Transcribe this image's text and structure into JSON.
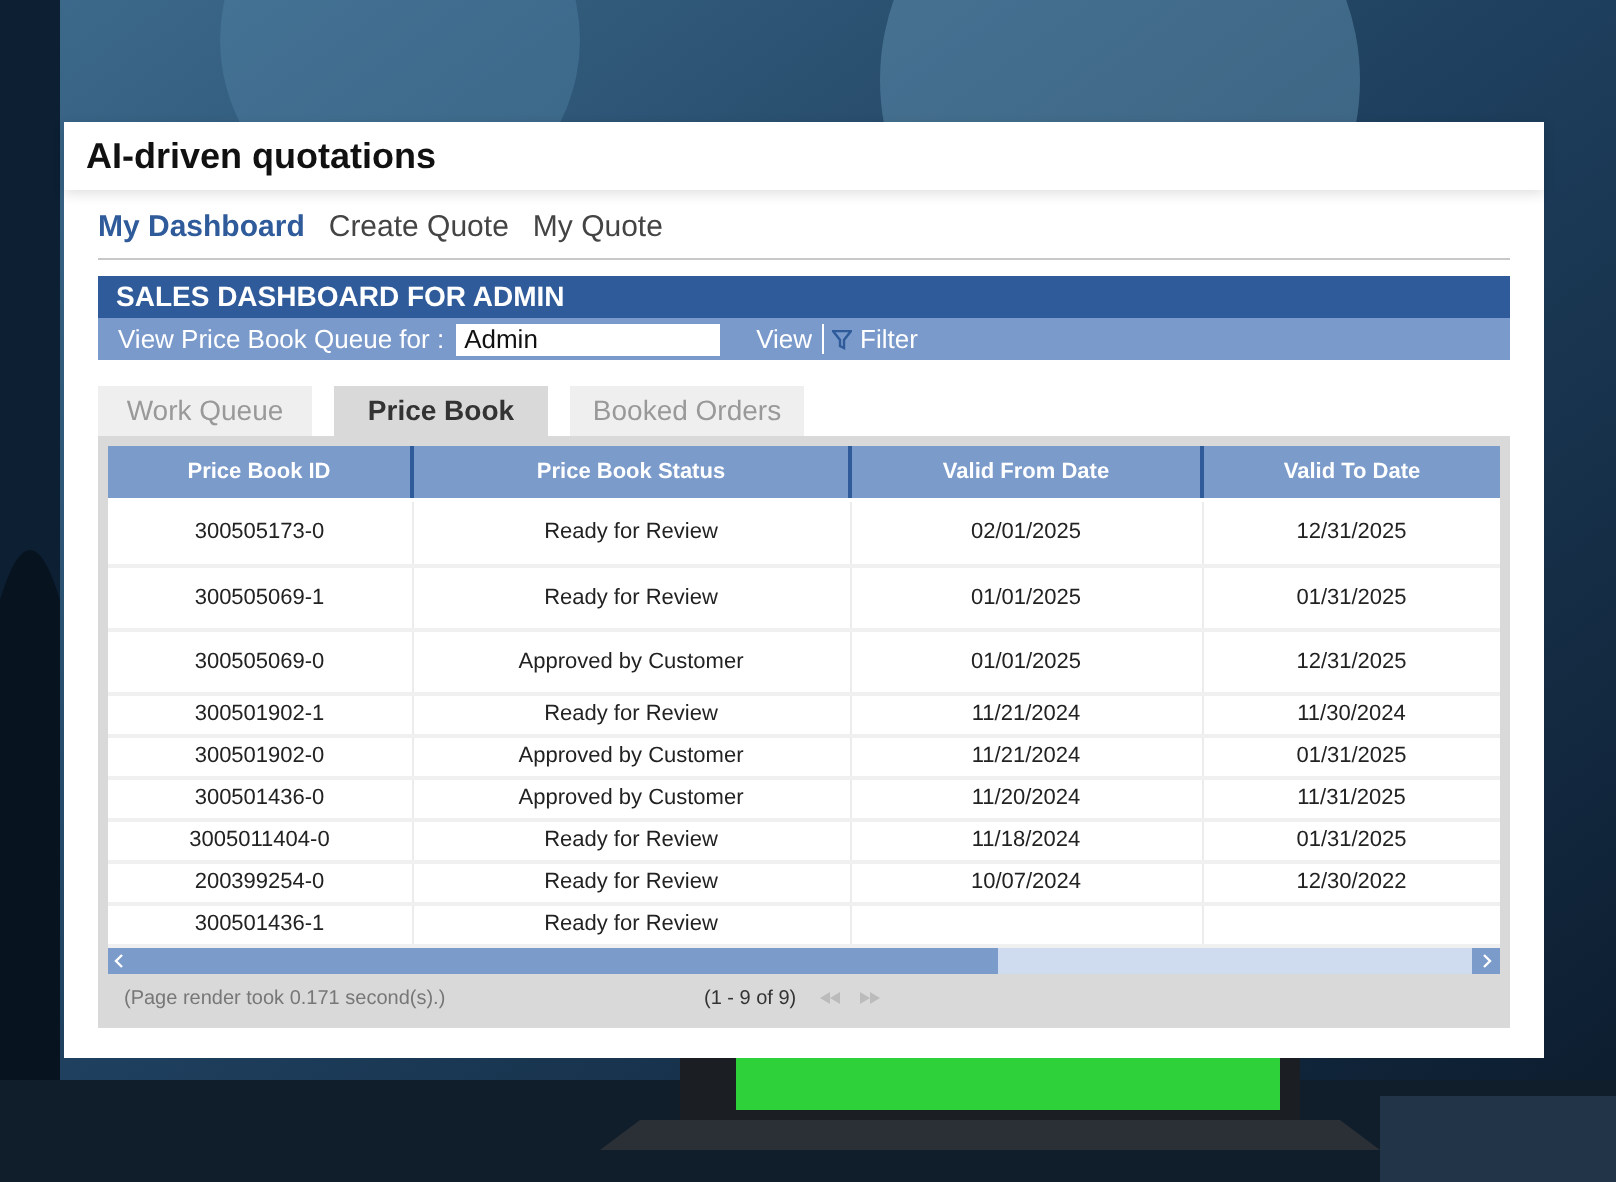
{
  "title": "AI-driven quotations",
  "nav_tabs": [
    {
      "label": "My Dashboard",
      "selected": true
    },
    {
      "label": "Create Quote",
      "selected": false
    },
    {
      "label": "My Quote",
      "selected": false
    }
  ],
  "dashboard": {
    "heading": "SALES DASHBOARD FOR ADMIN",
    "queue_label": "View Price Book Queue for :",
    "queue_field": {
      "value": "Admin"
    },
    "view_button": "View",
    "filter_button": "Filter"
  },
  "tabs": [
    {
      "label": "Work Queue",
      "selected": false
    },
    {
      "label": "Price Book",
      "selected": true
    },
    {
      "label": "Booked Orders",
      "selected": false
    }
  ],
  "table": {
    "columns": [
      "Price Book ID",
      "Price Book Status",
      "Valid From Date",
      "Valid To Date"
    ],
    "rows": [
      [
        "300505173-0",
        "Ready for Review",
        "02/01/2025",
        "12/31/2025"
      ],
      [
        "300505069-1",
        "Ready for Review",
        "01/01/2025",
        "01/31/2025"
      ],
      [
        "300505069-0",
        "Approved by Customer",
        "01/01/2025",
        "12/31/2025"
      ],
      [
        "300501902-1",
        "Ready for Review",
        "11/21/2024",
        "11/30/2024"
      ],
      [
        "300501902-0",
        "Approved by Customer",
        "11/21/2024",
        "01/31/2025"
      ],
      [
        "300501436-0",
        "Approved by Customer",
        "11/20/2024",
        "11/31/2025"
      ],
      [
        "3005011404-0",
        "Ready for Review",
        "11/18/2024",
        "01/31/2025"
      ],
      [
        "200399254-0",
        "Ready for Review",
        "10/07/2024",
        "12/30/2022"
      ],
      [
        "300501436-1",
        "Ready for Review"
      ]
    ]
  },
  "footer": {
    "render_time": "(Page render took 0.171 second(s).)",
    "page_info": "(1 - 9 of 9)"
  }
}
